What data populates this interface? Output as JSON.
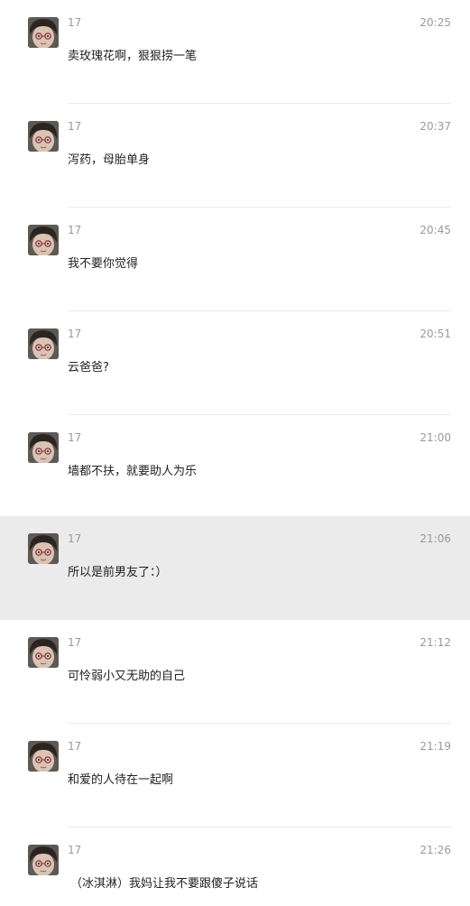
{
  "messages": [
    {
      "sender": "17",
      "time": "20:25",
      "text": "卖玫瑰花啊，狠狠捞一笔",
      "selected": false
    },
    {
      "sender": "17",
      "time": "20:37",
      "text": "泻药，母胎单身",
      "selected": false
    },
    {
      "sender": "17",
      "time": "20:45",
      "text": "我不要你觉得",
      "selected": false
    },
    {
      "sender": "17",
      "time": "20:51",
      "text": "云爸爸?",
      "selected": false
    },
    {
      "sender": "17",
      "time": "21:00",
      "text": "墙都不扶，就要助人为乐",
      "selected": false
    },
    {
      "sender": "17",
      "time": "21:06",
      "text": "所以是前男友了：）",
      "selected": true
    },
    {
      "sender": "17",
      "time": "21:12",
      "text": "可怜弱小又无助的自己",
      "selected": false
    },
    {
      "sender": "17",
      "time": "21:19",
      "text": "和爱的人待在一起啊",
      "selected": false
    },
    {
      "sender": "17",
      "time": "21:26",
      "text": "（冰淇淋）我妈让我不要跟傻子说话",
      "selected": false
    }
  ],
  "avatar_icon": "user-avatar-photo",
  "colors": {
    "selected_background": "#ebebeb",
    "meta_text": "#9a9a9a",
    "body_text": "#222222"
  }
}
